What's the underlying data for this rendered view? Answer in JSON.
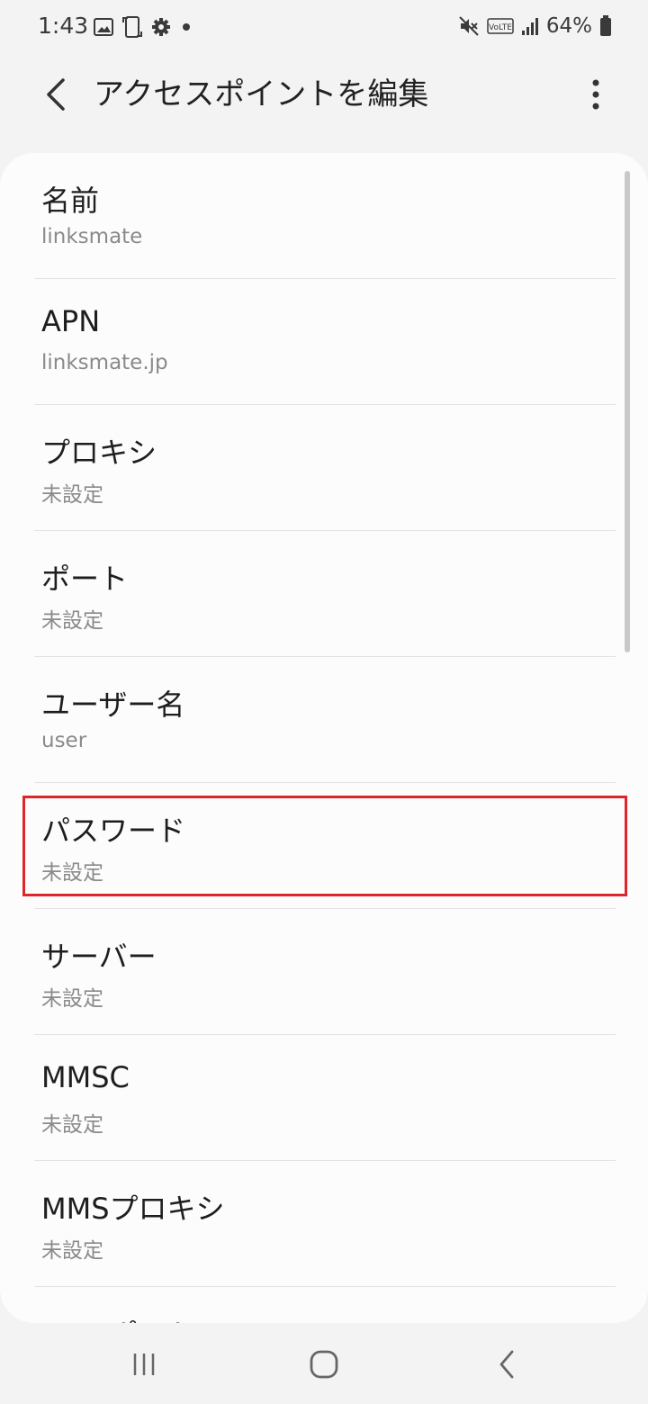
{
  "status_bar": {
    "time": "1:43",
    "battery": "64%",
    "icons": [
      "image-icon",
      "screenshot-icon",
      "gear-icon",
      "dot-icon",
      "mute-icon",
      "volte-icon",
      "signal-icon",
      "battery-icon"
    ],
    "volte_label": "VoLTE"
  },
  "app_bar": {
    "title": "アクセスポイントを編集"
  },
  "list": {
    "items": [
      {
        "title": "名前",
        "value": "linksmate"
      },
      {
        "title": "APN",
        "value": "linksmate.jp"
      },
      {
        "title": "プロキシ",
        "value": "未設定"
      },
      {
        "title": "ポート",
        "value": "未設定"
      },
      {
        "title": "ユーザー名",
        "value": "user"
      },
      {
        "title": "パスワード",
        "value": "未設定"
      },
      {
        "title": "サーバー",
        "value": "未設定"
      },
      {
        "title": "MMSC",
        "value": "未設定"
      },
      {
        "title": "MMSプロキシ",
        "value": "未設定"
      },
      {
        "title": "MMSポート",
        "value": ""
      }
    ]
  },
  "colors": {
    "highlight": "#e0242b",
    "background": "#f3f3f3",
    "card": "#fcfcfc"
  },
  "nav_bar": {
    "icons": [
      "recents-icon",
      "home-icon",
      "back-icon"
    ]
  }
}
